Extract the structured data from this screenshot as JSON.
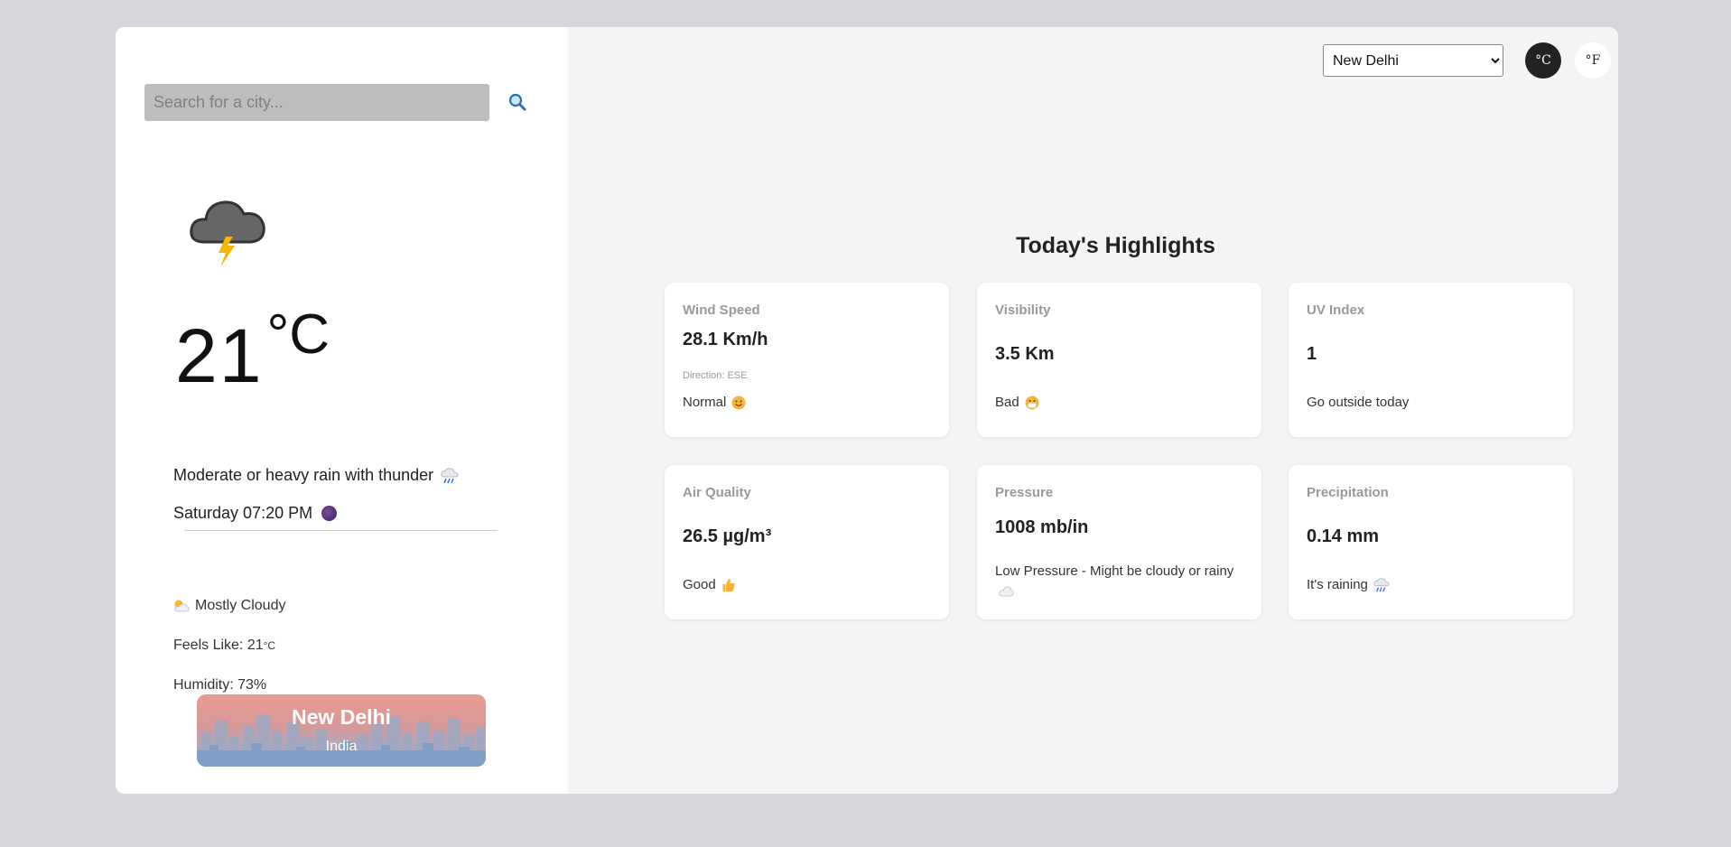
{
  "search": {
    "placeholder": "Search for a city..."
  },
  "current": {
    "temp": "21",
    "unit": "°C",
    "condition": "Moderate or heavy rain with thunder",
    "datetime": "Saturday 07:20 PM",
    "sky": "Mostly Cloudy",
    "feels_like_label": "Feels Like: 21",
    "feels_like_unit": "°C",
    "humidity": "Humidity: 73%"
  },
  "location": {
    "city": "New Delhi",
    "country": "India"
  },
  "controls": {
    "selected_city": "New Delhi",
    "city_options": [
      "New Delhi"
    ],
    "celsius": "°C",
    "fahrenheit": "°F"
  },
  "highlights": {
    "title": "Today's Highlights",
    "cards": [
      {
        "label": "Wind Speed",
        "value": "28.1 Km/h",
        "sub": "Direction: ESE",
        "status": "Normal"
      },
      {
        "label": "Visibility",
        "value": "3.5 Km",
        "status": "Bad"
      },
      {
        "label": "UV Index",
        "value": "1",
        "status": "Go outside today"
      },
      {
        "label": "Air Quality",
        "value": "26.5 µg/m³",
        "status": "Good"
      },
      {
        "label": "Pressure",
        "value": "1008 mb/in",
        "status": "Low Pressure - Might be cloudy or rainy"
      },
      {
        "label": "Precipitation",
        "value": "0.14 mm",
        "status": "It's raining"
      }
    ]
  },
  "colors": {
    "background": "#d6d7db",
    "panel": "#f4f4f6",
    "card": "#ffffff",
    "accent_dark": "#222222"
  }
}
